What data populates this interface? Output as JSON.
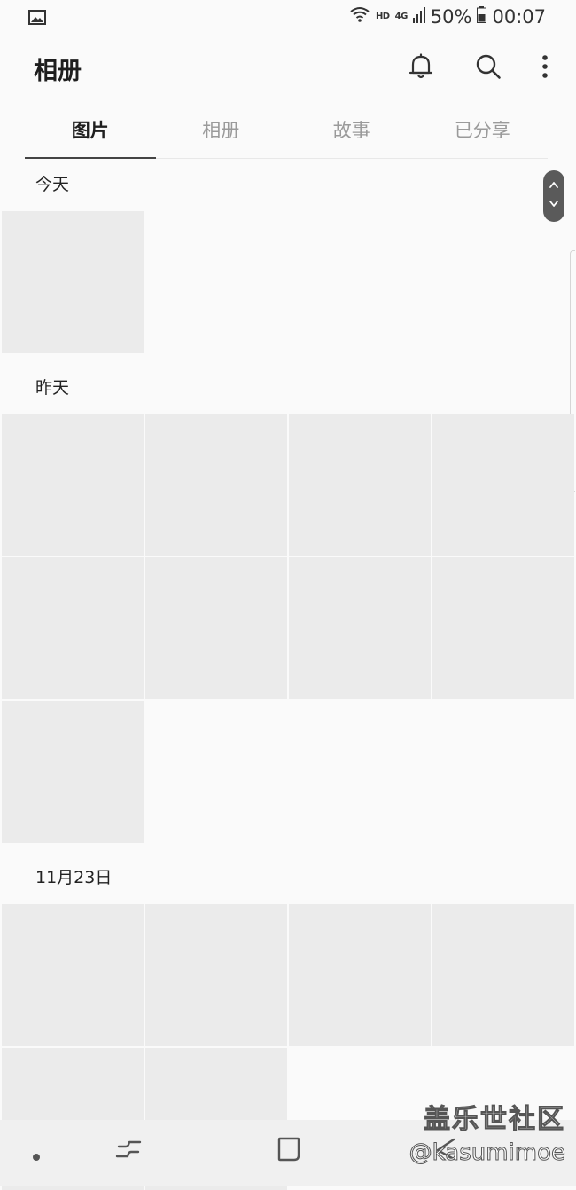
{
  "status_bar": {
    "hd_label": "HD",
    "network_label": "4G",
    "battery": "50%",
    "time": "00:07"
  },
  "app_bar": {
    "title": "相册"
  },
  "tabs": [
    {
      "label": "图片",
      "active": true
    },
    {
      "label": "相册",
      "active": false
    },
    {
      "label": "故事",
      "active": false
    },
    {
      "label": "已分享",
      "active": false
    }
  ],
  "sections": [
    {
      "label": "今天",
      "photo_count": 1
    },
    {
      "label": "昨天",
      "photo_count": 9
    },
    {
      "label": "11月23日",
      "photo_count": 6
    }
  ],
  "watermark": {
    "site": "盖乐世社区",
    "user": "@kasumimoe"
  },
  "icons": {
    "status_left": "image-icon",
    "wifi": "wifi-icon",
    "signal": "signal-icon",
    "battery": "battery-icon",
    "notifications": "bell-icon",
    "search": "search-icon",
    "more": "more-vert-icon",
    "fast_scroll": "fast-scroll-icon",
    "nav_recents": "recents-icon",
    "nav_home": "home-icon",
    "nav_back": "back-icon"
  },
  "colors": {
    "background": "#fafafa",
    "thumbnail": "#ebebeb",
    "active_tab": "#1f1f1f",
    "inactive_tab": "#9a9a9a",
    "scroll_thumb": "#5a5a5a"
  }
}
